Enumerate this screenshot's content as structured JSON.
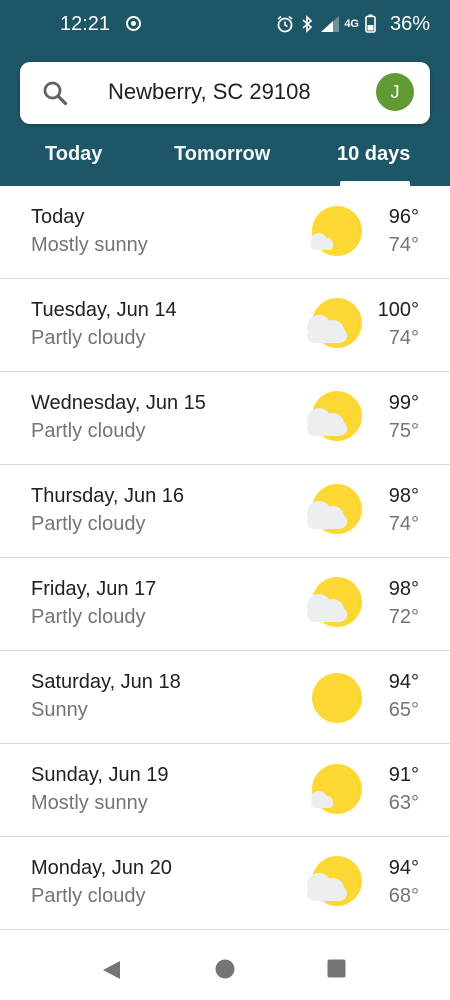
{
  "status_bar": {
    "time": "12:21",
    "battery_percent": "36%",
    "network_label": "4G"
  },
  "search": {
    "location": "Newberry, SC 29108",
    "avatar_letter": "J"
  },
  "tabs": [
    {
      "label": "Today",
      "selected": false
    },
    {
      "label": "Tomorrow",
      "selected": false
    },
    {
      "label": "10 days",
      "selected": true
    }
  ],
  "forecast": [
    {
      "day": "Today",
      "condition": "Mostly sunny",
      "high": "96°",
      "low": "74°",
      "icon": "mostly-sunny-icon"
    },
    {
      "day": "Tuesday, Jun 14",
      "condition": "Partly cloudy",
      "high": "100°",
      "low": "74°",
      "icon": "partly-cloudy-icon"
    },
    {
      "day": "Wednesday, Jun 15",
      "condition": "Partly cloudy",
      "high": "99°",
      "low": "75°",
      "icon": "partly-cloudy-icon"
    },
    {
      "day": "Thursday, Jun 16",
      "condition": "Partly cloudy",
      "high": "98°",
      "low": "74°",
      "icon": "partly-cloudy-icon"
    },
    {
      "day": "Friday, Jun 17",
      "condition": "Partly cloudy",
      "high": "98°",
      "low": "72°",
      "icon": "partly-cloudy-icon"
    },
    {
      "day": "Saturday, Jun 18",
      "condition": "Sunny",
      "high": "94°",
      "low": "65°",
      "icon": "sunny-icon"
    },
    {
      "day": "Sunday, Jun 19",
      "condition": "Mostly sunny",
      "high": "91°",
      "low": "63°",
      "icon": "mostly-sunny-icon"
    },
    {
      "day": "Monday, Jun 20",
      "condition": "Partly cloudy",
      "high": "94°",
      "low": "68°",
      "icon": "partly-cloudy-icon"
    }
  ],
  "colors": {
    "header_bg": "#1d5666",
    "avatar_bg": "#5f9b32",
    "sun": "#fdd835",
    "cloud": "#eceff1"
  }
}
